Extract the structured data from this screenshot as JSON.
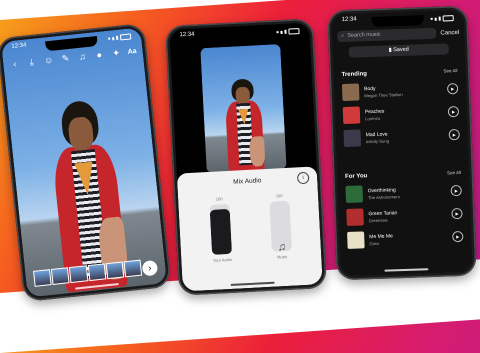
{
  "status_time": "12:34",
  "phone1": {
    "toolbar": {
      "back_icon": "chevron-left-icon",
      "text_tool": "Aa"
    }
  },
  "phone2": {
    "mix_title": "Mix Audio",
    "left_slider": {
      "value_label": "100",
      "name": "Your Audio",
      "level": 0.9
    },
    "right_slider": {
      "value_label": "100",
      "name": "Music",
      "level": 0.0
    }
  },
  "phone3": {
    "search_placeholder": "Search music",
    "cancel_label": "Cancel",
    "saved_label": "Saved",
    "trending": {
      "heading": "Trending",
      "see_all": "See All",
      "songs": [
        {
          "title": "Body",
          "artist": "Megan Thee Stallion",
          "color": "#8a6a4f"
        },
        {
          "title": "Peaches",
          "artist": "Lorenzo",
          "color": "#d13a3a"
        },
        {
          "title": "Mad Love",
          "artist": "Infinity Song",
          "color": "#3a3a4a"
        }
      ]
    },
    "for_you": {
      "heading": "For You",
      "see_all": "See All",
      "songs": [
        {
          "title": "Overthinking",
          "artist": "The Astronomers",
          "color": "#2d6b3a"
        },
        {
          "title": "Green Tarian",
          "artist": "Greenswe",
          "color": "#b22d2d"
        },
        {
          "title": "Me Me Me",
          "artist": "Grea",
          "color": "#e8e1c8"
        }
      ]
    }
  }
}
